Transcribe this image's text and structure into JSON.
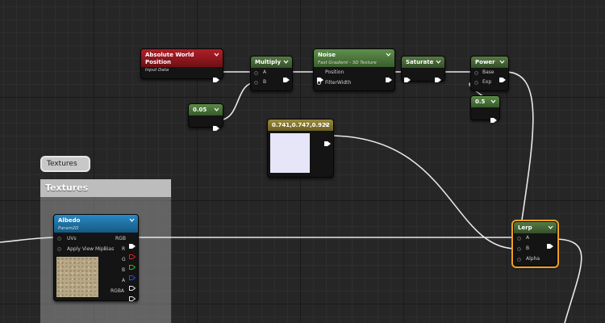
{
  "comment": {
    "title": "Textures",
    "bubble_label": "Textures"
  },
  "nodes": {
    "absolute_world_position": {
      "title": "Absolute World Position",
      "subtitle": "Input Data"
    },
    "multiply": {
      "title": "Multiply",
      "pin_a": "A",
      "pin_b": "B"
    },
    "constant_005": {
      "title": "0.05"
    },
    "noise": {
      "title": "Noise",
      "subtitle": "Fast Gradient - 3D Texture",
      "pin_position": "Position",
      "pin_filterwidth": "FilterWidth"
    },
    "saturate": {
      "title": "Saturate"
    },
    "power": {
      "title": "Power",
      "pin_base": "Base",
      "pin_exp": "Exp"
    },
    "constant_05": {
      "title": "0.5"
    },
    "vector_color": {
      "title": "0.741,0.747,0.922",
      "swatch_color": "#e6e6f8"
    },
    "albedo": {
      "title": "Albedo",
      "subtitle": "Param2D",
      "pin_uvs": "UVs",
      "pin_mipbias": "Apply View MipBias",
      "out_rgb": "RGB",
      "out_r": "R",
      "out_g": "G",
      "out_b": "B",
      "out_a": "A",
      "out_rgba": "RGBA"
    },
    "lerp": {
      "title": "Lerp",
      "pin_a": "A",
      "pin_b": "B",
      "pin_alpha": "Alpha"
    }
  },
  "colors": {
    "param_header": "#9a1a22",
    "math_header": "#3a5a2e",
    "texture_header": "#1e6ea0",
    "selection": "#f0a020",
    "pin_r": "#e02020",
    "pin_g": "#20c020",
    "pin_b": "#2050ff"
  }
}
